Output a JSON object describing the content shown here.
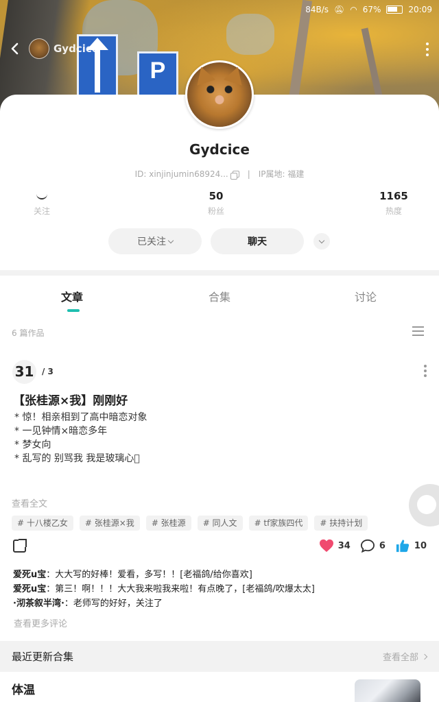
{
  "status_bar": {
    "speed": "84B/s",
    "battery": "67%",
    "time": "20:09"
  },
  "header": {
    "username": "Gydcice"
  },
  "profile": {
    "name": "Gydcice",
    "id_text": "ID: xinjinjumin68924...",
    "separator": "|",
    "ip_text": "IP属地:  福建",
    "stats": [
      {
        "value": "",
        "label": "关注"
      },
      {
        "value": "50",
        "label": "粉丝"
      },
      {
        "value": "1165",
        "label": "热度"
      }
    ],
    "follow_label": "已关注",
    "chat_label": "聊天"
  },
  "tabs": [
    {
      "label": "文章",
      "active": true
    },
    {
      "label": "合集",
      "active": false
    },
    {
      "label": "讨论",
      "active": false
    }
  ],
  "works_count": "6 篇作品",
  "post": {
    "chapter": "31",
    "chapter_total": "/ 3",
    "title": "【张桂源×我】刚刚好",
    "lines": [
      "* 惊！相亲相到了高中暗恋对象",
      "* 一见钟情×暗恋多年",
      "* 梦女向",
      "* 乱写的 别骂我 我是玻璃心\u0000"
    ],
    "read_more": "查看全文",
    "tags": [
      "# 十八楼乙女",
      "# 张桂源×我",
      "# 张桂源",
      "# 同人文",
      "# tf家族四代",
      "# 扶持计划"
    ],
    "likes": "34",
    "comments": "6",
    "thumbs": "10"
  },
  "comments": [
    {
      "user": "爱死u宝",
      "text": "：大大写的好棒！爱看，多写！！[老福鸽/给你喜欢]"
    },
    {
      "user": "爱死u宝",
      "text": "：第三！啊！！！大大我来啦我来啦！有点晚了，[老福鸽/吹爆太太]"
    },
    {
      "user": "·沏茶叙半湾·",
      "text": "：老师写的好好，关注了"
    }
  ],
  "more_comments": "查看更多评论",
  "collections": {
    "title": "最近更新合集",
    "see_all": "查看全部",
    "first_name": "体温"
  },
  "colors": {
    "accent": "#1fbfb0",
    "heart": "#f04a6f",
    "thumb": "#1ea7e8"
  }
}
